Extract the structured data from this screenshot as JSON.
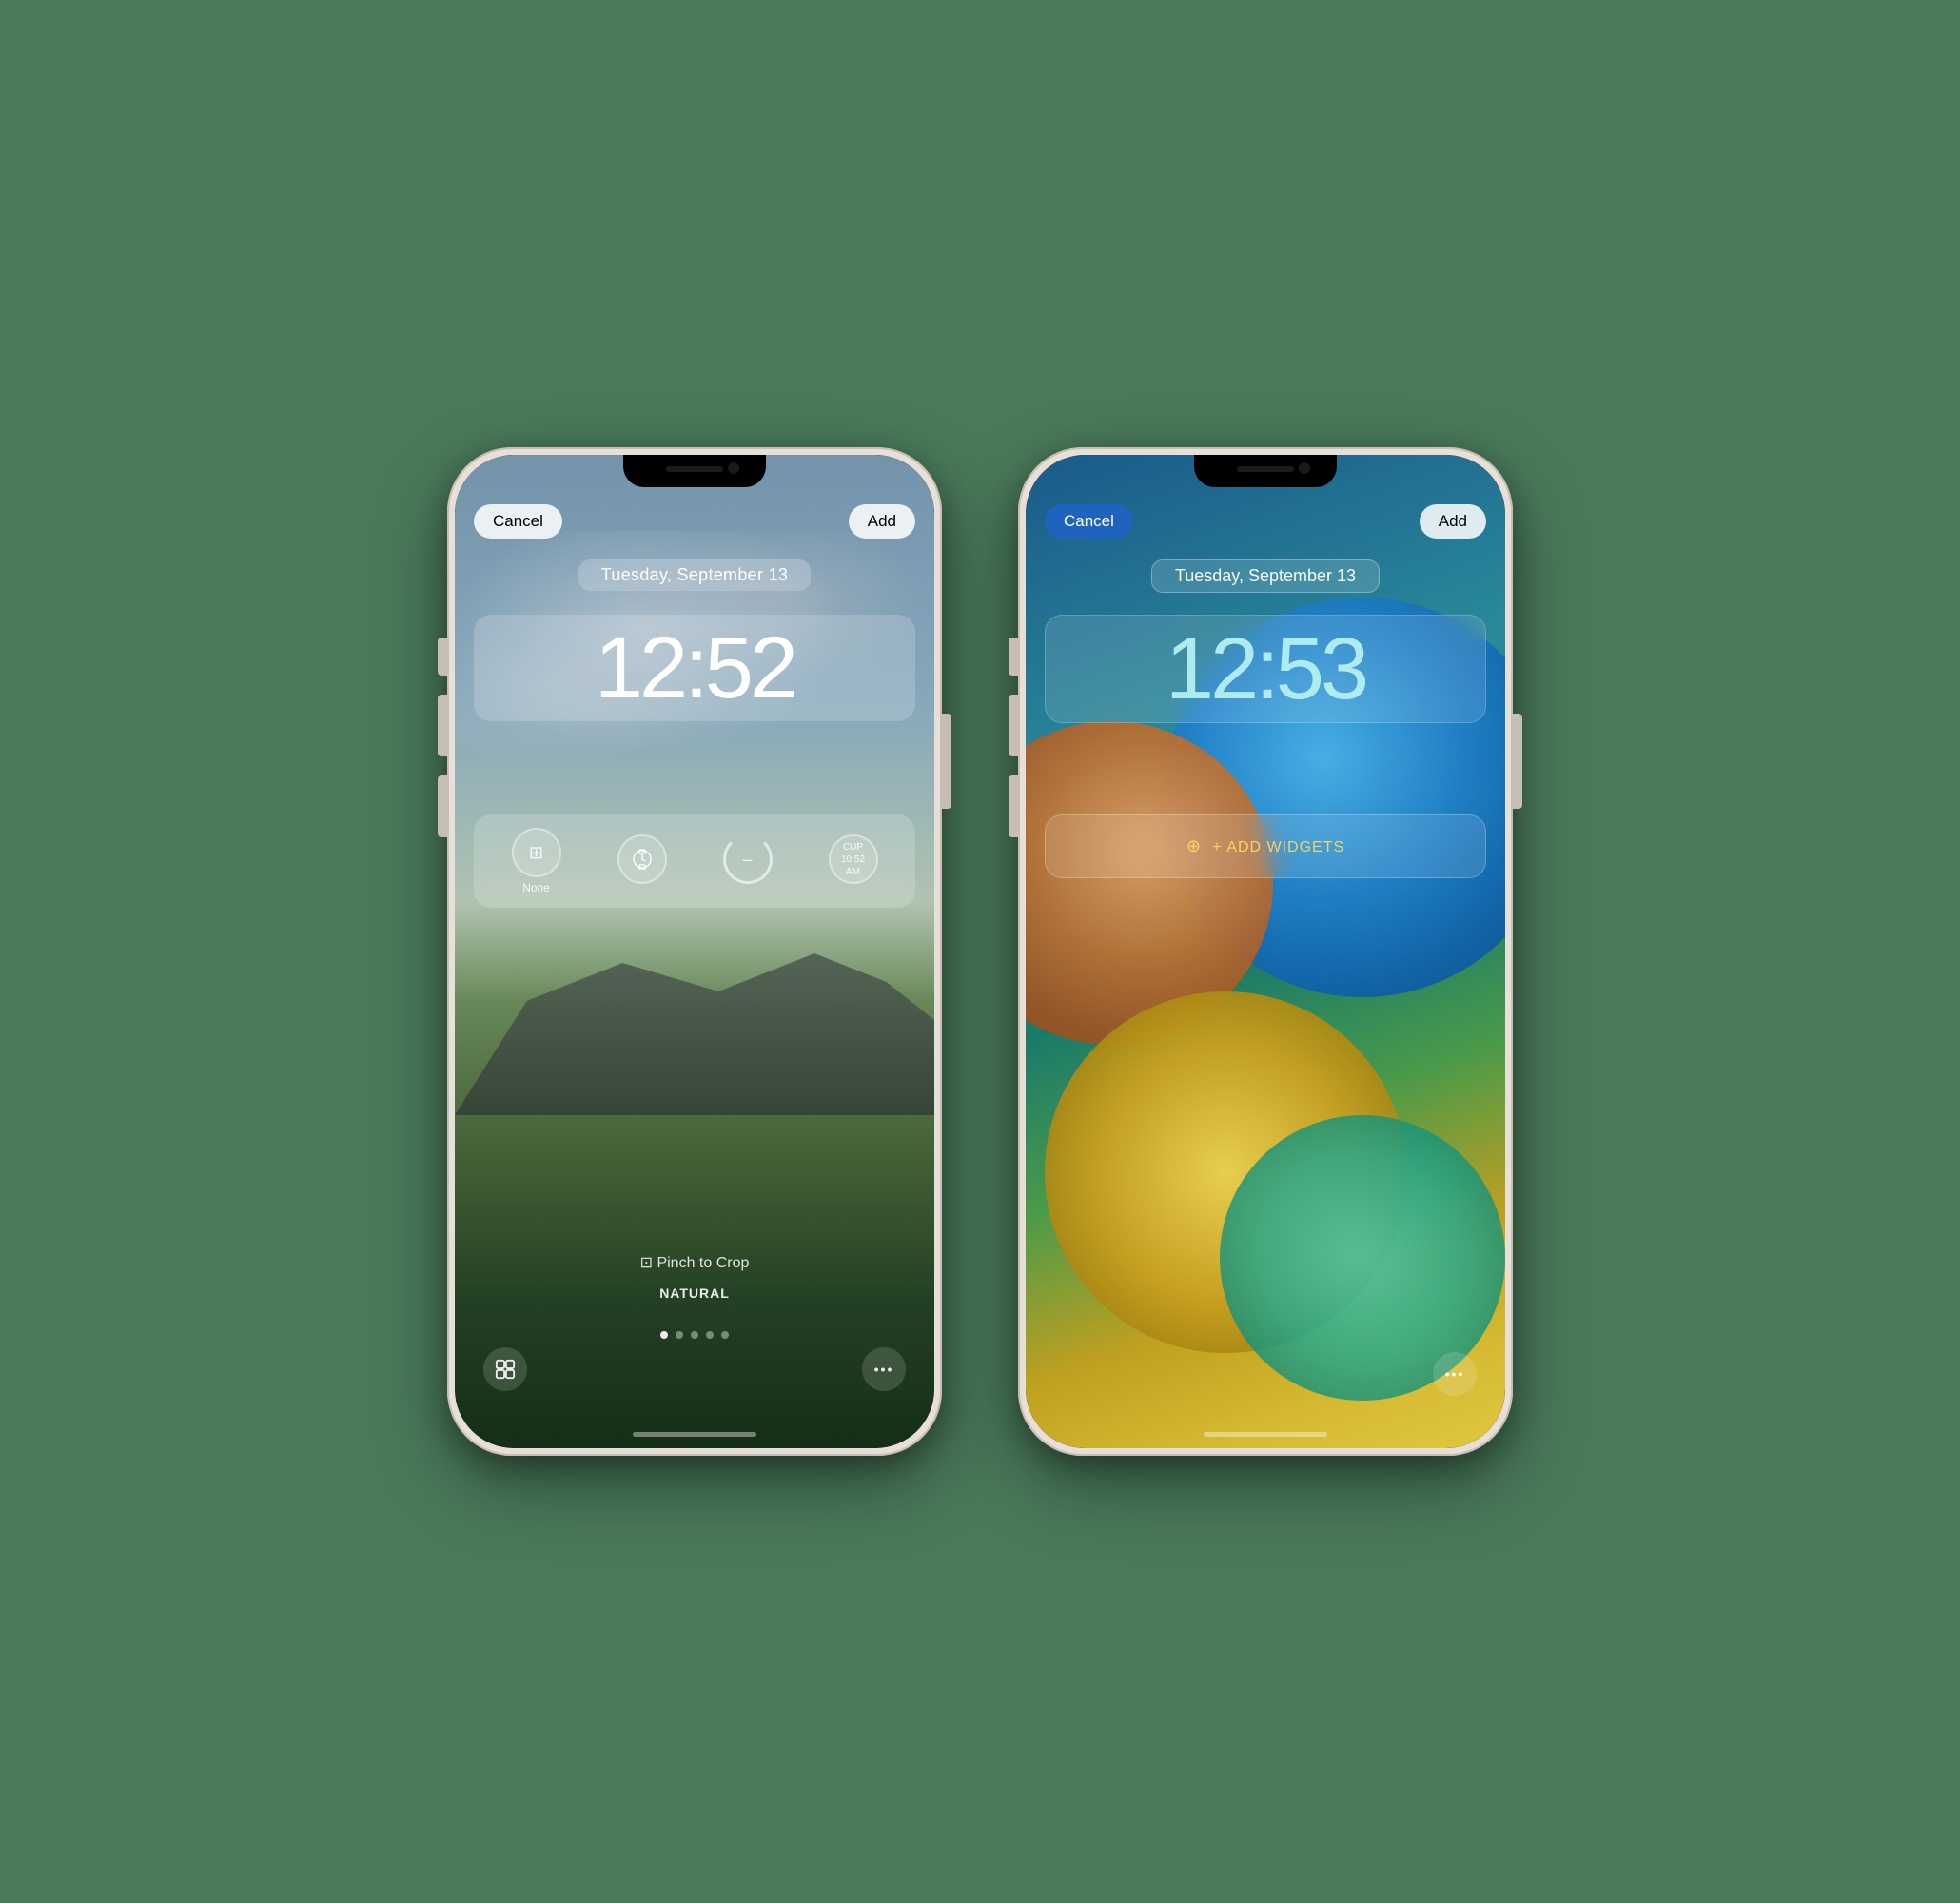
{
  "page": {
    "background_color": "#4a7a5a"
  },
  "phone1": {
    "cancel_label": "Cancel",
    "add_label": "Add",
    "date": "Tuesday, September 13",
    "time": "12:52",
    "widgets": [
      {
        "label": "None",
        "icon": "grid-icon"
      },
      {
        "label": "",
        "icon": "watch-icon"
      },
      {
        "label": "–",
        "icon": "ring-icon"
      },
      {
        "label": "CUP\n10:52\nAM",
        "icon": "cup-icon"
      }
    ],
    "pinch_label": "⊡ Pinch to Crop",
    "filter_label": "NATURAL",
    "dots_count": 5,
    "active_dot": 0,
    "gallery_icon": "📷",
    "more_icon": "•••"
  },
  "phone2": {
    "cancel_label": "Cancel",
    "add_label": "Add",
    "date": "Tuesday, September 13",
    "time": "12:53",
    "add_widgets_text": "+ ADD WIDGETS",
    "more_icon": "•••"
  }
}
